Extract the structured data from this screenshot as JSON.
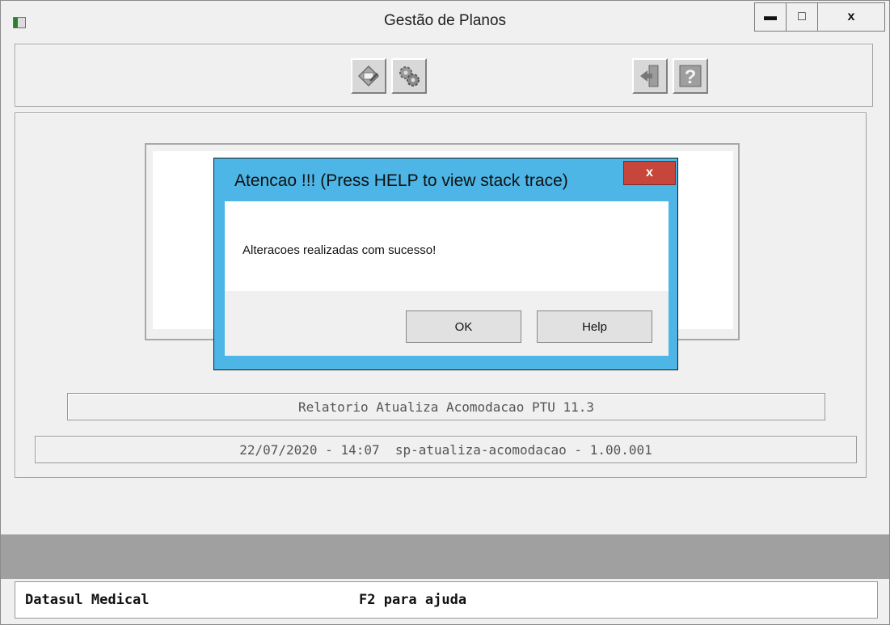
{
  "window": {
    "title": "Gestão de Planos",
    "minimize_label": "▬",
    "maximize_label": "□",
    "close_label": "x"
  },
  "toolbar": {
    "buttons": [
      {
        "icon": "edit-doc-icon"
      },
      {
        "icon": "settings-icon"
      },
      {
        "icon": "exit-icon"
      },
      {
        "icon": "help-icon"
      }
    ]
  },
  "report": {
    "title": "Relatorio Atualiza Acomodacao PTU 11.3",
    "version_line": "22/07/2020 - 14:07  sp-atualiza-acomodacao - 1.00.001"
  },
  "dialog": {
    "title": "Atencao !!! (Press HELP to view stack trace)",
    "close_label": "x",
    "message": "Alteracoes realizadas com sucesso!",
    "ok_label": "OK",
    "help_label": "Help"
  },
  "statusbar": {
    "left": "Datasul Medical",
    "right": "F2 para ajuda"
  },
  "colors": {
    "dialog_frame": "#4db6e6",
    "dialog_close": "#c7463b",
    "status_band": "#a0a0a0"
  }
}
